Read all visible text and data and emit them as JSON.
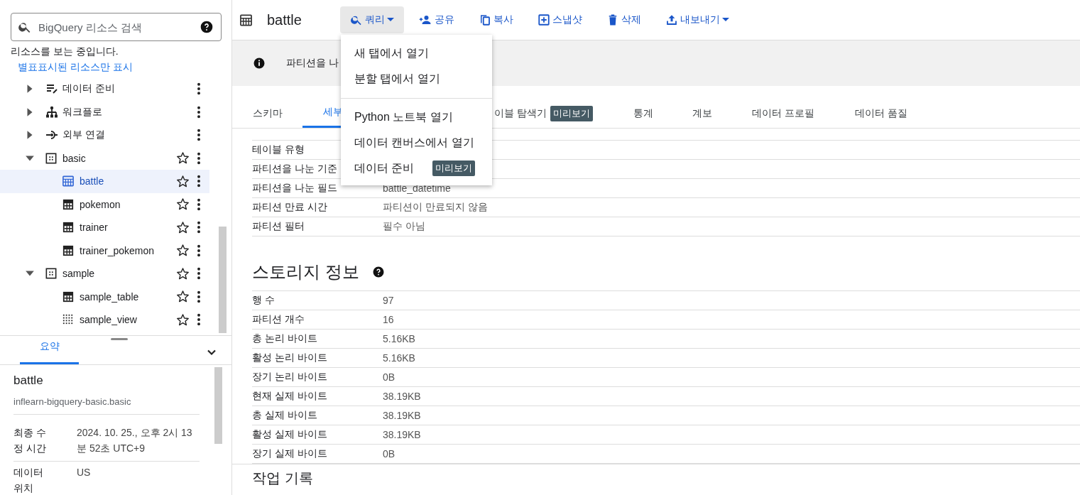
{
  "search": {
    "placeholder": "BigQuery 리소스 검색"
  },
  "explorer_status": "리소스를 보는 중입니다.",
  "starred_link": "별표표시된 리소스만 표시",
  "tree": [
    {
      "label": "데이터 준비",
      "kind": "data-prep",
      "expanded": false,
      "selected": false
    },
    {
      "label": "워크플로",
      "kind": "workflow",
      "expanded": false,
      "selected": false
    },
    {
      "label": "외부 연결",
      "kind": "connection",
      "expanded": false,
      "selected": false
    },
    {
      "label": "basic",
      "kind": "dataset",
      "expanded": true,
      "selected": false,
      "starred": false,
      "children": [
        {
          "label": "battle",
          "kind": "partitioned-table",
          "selected": true,
          "starred": false
        },
        {
          "label": "pokemon",
          "kind": "table",
          "selected": false,
          "starred": false
        },
        {
          "label": "trainer",
          "kind": "table",
          "selected": false,
          "starred": false
        },
        {
          "label": "trainer_pokemon",
          "kind": "table",
          "selected": false,
          "starred": false
        }
      ]
    },
    {
      "label": "sample",
      "kind": "dataset",
      "expanded": true,
      "selected": false,
      "starred": false,
      "children": [
        {
          "label": "sample_table",
          "kind": "table",
          "selected": false,
          "starred": false
        },
        {
          "label": "sample_view",
          "kind": "view",
          "selected": false,
          "starred": false
        }
      ]
    }
  ],
  "bottom_panel": {
    "tabs": [
      {
        "label": "요약",
        "selected": true
      }
    ],
    "title": "battle",
    "subtitle": "inflearn-bigquery-basic.basic",
    "rows": [
      {
        "label": "최종 수정 시간",
        "value": "2024. 10. 25., 오후 2시 13분 52초 UTC+9"
      },
      {
        "label": "데이터 위치",
        "value": "US"
      }
    ]
  },
  "header": {
    "title": "battle",
    "actions": [
      {
        "label": "쿼리",
        "kind": "search",
        "dropdown": true,
        "selected": true
      },
      {
        "label": "공유",
        "kind": "share",
        "dropdown": false,
        "selected": false
      },
      {
        "label": "복사",
        "kind": "copy",
        "dropdown": false,
        "selected": false
      },
      {
        "label": "스냅샷",
        "kind": "snapshot",
        "dropdown": false,
        "selected": false
      },
      {
        "label": "삭제",
        "kind": "delete",
        "dropdown": false,
        "selected": false
      },
      {
        "label": "내보내기",
        "kind": "export",
        "dropdown": true,
        "selected": false
      }
    ]
  },
  "query_menu": {
    "items": [
      {
        "label": "새 탭에서 열기",
        "divider_before": false
      },
      {
        "label": "분할 탭에서 열기",
        "divider_before": false
      },
      {
        "label": "Python 노트북 열기",
        "divider_before": true
      },
      {
        "label": "데이터 캔버스에서 열기",
        "divider_before": false
      },
      {
        "label": "데이터 준비",
        "divider_before": false,
        "badge": "미리보기"
      }
    ]
  },
  "banner": {
    "text": "파티션을 나"
  },
  "tabs": [
    {
      "label": "스키마",
      "selected": false
    },
    {
      "label": "세부",
      "selected": true
    },
    {
      "label": "이블 탐색기",
      "selected": false,
      "badge": "미리보기"
    },
    {
      "label": "통계",
      "selected": false
    },
    {
      "label": "계보",
      "selected": false
    },
    {
      "label": "데이터 프로필",
      "selected": false
    },
    {
      "label": "데이터 품질",
      "selected": false
    }
  ],
  "details": [
    {
      "label": "테이블 유형"
    },
    {
      "label": "파티션을 나눈 기준"
    },
    {
      "label": "파티션을 나눈 필드",
      "value": "battle_datetime"
    },
    {
      "label": "파티션 만료 시간",
      "value": "파티션이 만료되지 않음"
    },
    {
      "label": "파티션 필터",
      "value": "필수 아님"
    }
  ],
  "storage": {
    "title": "스토리지 정보",
    "rows": [
      {
        "label": "행 수",
        "value": "97"
      },
      {
        "label": "파티션 개수",
        "value": "16"
      },
      {
        "label": "총 논리 바이트",
        "value": "5.16KB"
      },
      {
        "label": "활성 논리 바이트",
        "value": "5.16KB"
      },
      {
        "label": "장기 논리 바이트",
        "value": "0B"
      },
      {
        "label": "현재 실제 바이트",
        "value": "38.19KB"
      },
      {
        "label": "총 실제 바이트",
        "value": "38.19KB"
      },
      {
        "label": "활성 실제 바이트",
        "value": "38.19KB"
      },
      {
        "label": "장기 실제 바이트",
        "value": "0B"
      }
    ]
  },
  "job_history": {
    "title": "작업 기록"
  }
}
